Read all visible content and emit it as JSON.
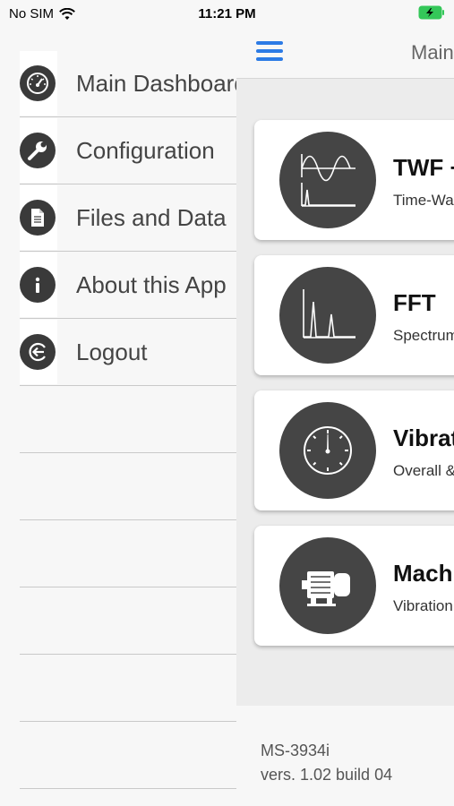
{
  "status": {
    "carrier": "No SIM",
    "time": "11:21 PM"
  },
  "menu": {
    "items": [
      {
        "label": "Main Dashboard",
        "icon": "speedometer-icon"
      },
      {
        "label": "Configuration",
        "icon": "wrench-icon"
      },
      {
        "label": "Files and Data",
        "icon": "document-icon"
      },
      {
        "label": "About this App",
        "icon": "info-icon"
      },
      {
        "label": "Logout",
        "icon": "logout-icon"
      }
    ]
  },
  "main": {
    "title": "Main",
    "cards": [
      {
        "title": "TWF +",
        "subtitle": "Time-Wa",
        "icon": "waveform-icon"
      },
      {
        "title": "FFT",
        "subtitle": "Spectrum",
        "icon": "spectrum-icon"
      },
      {
        "title": "Vibration",
        "subtitle": "Overall &",
        "icon": "gauge-icon"
      },
      {
        "title": "Machine",
        "subtitle": "Vibration",
        "icon": "motor-icon"
      }
    ]
  },
  "footer": {
    "model": "MS-3934i",
    "version": "vers. 1.02 build 04"
  },
  "colors": {
    "accent": "#2c7be5",
    "icon_bg": "#3a3a3a",
    "battery": "#34c759"
  }
}
